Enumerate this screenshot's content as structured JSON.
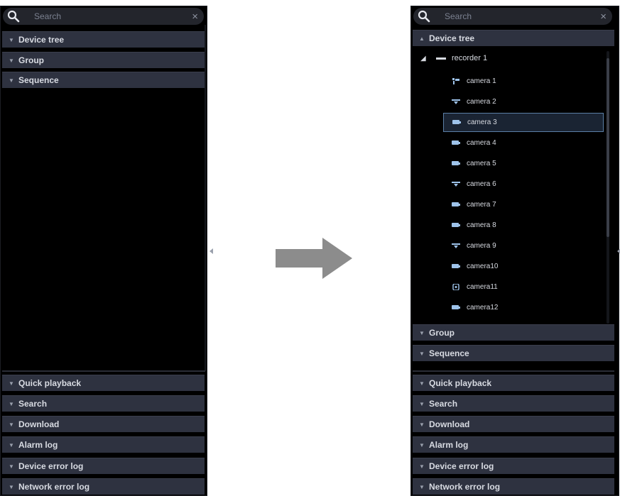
{
  "search": {
    "placeholder": "Search",
    "clear_symbol": "×"
  },
  "left_panel": {
    "top_sections": [
      {
        "label": "Device tree",
        "expanded": false
      },
      {
        "label": "Group",
        "expanded": false
      },
      {
        "label": "Sequence",
        "expanded": false
      }
    ],
    "bottom_sections": [
      {
        "label": "Quick playback"
      },
      {
        "label": "Search"
      },
      {
        "label": "Download"
      },
      {
        "label": "Alarm log"
      },
      {
        "label": "Device error log"
      },
      {
        "label": "Network error log"
      }
    ]
  },
  "right_panel": {
    "device_tree_label": "Device tree",
    "recorder_label": "recorder 1",
    "cameras": [
      {
        "label": "camera 1",
        "icon": "ptz-camera-icon"
      },
      {
        "label": "camera 2",
        "icon": "dome-camera-icon"
      },
      {
        "label": "camera 3",
        "icon": "box-camera-icon",
        "selected": true
      },
      {
        "label": "camera 4",
        "icon": "box-camera-icon"
      },
      {
        "label": "camera 5",
        "icon": "box-camera-icon"
      },
      {
        "label": "camera 6",
        "icon": "dome-camera-icon"
      },
      {
        "label": "camera 7",
        "icon": "box-camera-icon"
      },
      {
        "label": "camera 8",
        "icon": "box-camera-icon"
      },
      {
        "label": "camera 9",
        "icon": "dome-camera-icon"
      },
      {
        "label": "camera10",
        "icon": "box-camera-icon"
      },
      {
        "label": "camera11",
        "icon": "fisheye-camera-icon"
      },
      {
        "label": "camera12",
        "icon": "box-camera-icon"
      }
    ],
    "lower_sections": [
      {
        "label": "Group"
      },
      {
        "label": "Sequence"
      }
    ],
    "bottom_sections": [
      {
        "label": "Quick playback"
      },
      {
        "label": "Search"
      },
      {
        "label": "Download"
      },
      {
        "label": "Alarm log"
      },
      {
        "label": "Device error log"
      },
      {
        "label": "Network error log"
      }
    ]
  },
  "colors": {
    "panel_background": "#000000",
    "section_bar": "#2e3240",
    "selection_border": "#5b7fa6",
    "arrow": "#8c8c8c"
  }
}
